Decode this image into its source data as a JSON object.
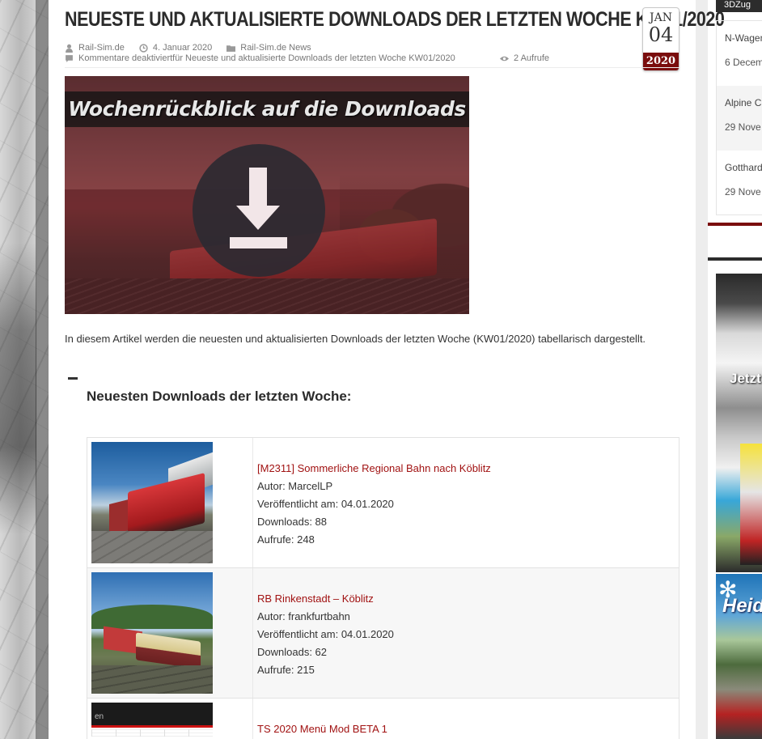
{
  "article": {
    "title": "Neueste und aktualisierte Downloads der letzten Woche KW01/2020",
    "date_badge": {
      "month": "JAN",
      "day": "04",
      "year": "2020"
    },
    "meta": {
      "author": "Rail-Sim.de",
      "date": "4. Januar 2020",
      "category": "Rail-Sim.de News",
      "comments": "Kommentare deaktiviertfür Neueste und aktualisierte Downloads der letzten Woche KW01/2020",
      "views": "2 Aufrufe"
    },
    "hero_text": "Wochenrückblick auf die Downloads",
    "intro": "In diesem Artikel werden die neuesten und aktualisierten Downloads der letzten Woche (KW01/2020) tabellarisch dargestellt.",
    "section_heading": "Neuesten Downloads der letzten Woche:"
  },
  "downloads": [
    {
      "title": "[M2311] Sommerliche Regional Bahn nach Köblitz",
      "author": "Autor: MarcelLP",
      "published": "Veröffentlicht am: 04.01.2020",
      "downloads": "Downloads: 88",
      "views": "Aufrufe: 248"
    },
    {
      "title": "RB Rinkenstadt – Köblitz",
      "author": "Autor: frankfurtbahn",
      "published": "Veröffentlicht am: 04.01.2020",
      "downloads": "Downloads: 62",
      "views": "Aufrufe: 215"
    },
    {
      "title": "TS 2020 Menü Mod BETA 1",
      "thumb_text": "en"
    }
  ],
  "sidebar": {
    "tab": "3DZug",
    "items": [
      {
        "title": "N-Wagen",
        "date": "6 Decem"
      },
      {
        "title": "Alpine C",
        "date": "29 Nove"
      },
      {
        "title": "Gotthard",
        "date": "29 Nove"
      }
    ],
    "ad1_text": "Jetzt",
    "ad2_text": "Heid"
  },
  "colors": {
    "accent": "#7a0d0d",
    "link": "#a11212",
    "title": "#2b2b2b"
  },
  "icons": [
    "user-icon",
    "clock-icon",
    "folder-icon",
    "comment-icon",
    "eye-icon",
    "download-icon",
    "edelweiss-icon"
  ]
}
